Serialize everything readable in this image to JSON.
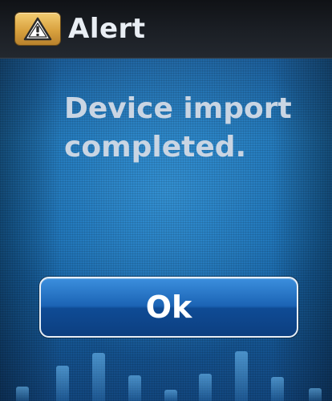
{
  "dialog": {
    "title": "Alert",
    "message_line1": "Device import",
    "message_line2": "completed.",
    "ok_label": "Ok"
  },
  "icons": {
    "title_icon": "warning-icon"
  },
  "colors": {
    "badge": "#e0ad4c",
    "background_blue": "#1f73b5",
    "title_bar": "#1b1f25",
    "message_text": "#c9d5e3"
  }
}
